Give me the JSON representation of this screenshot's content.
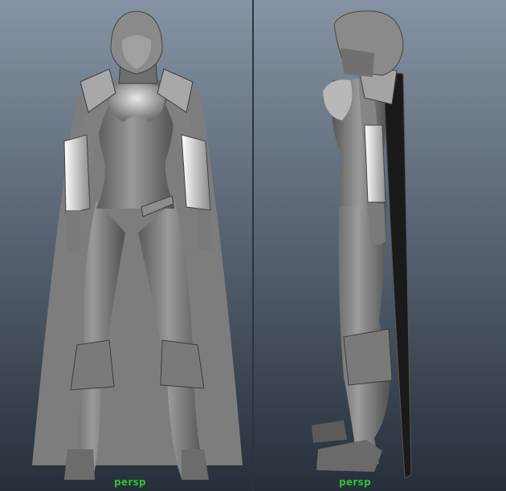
{
  "viewports": {
    "front": {
      "camera_label": "persp",
      "subject": "character-front"
    },
    "side": {
      "camera_label": "persp",
      "subject": "character-side"
    }
  },
  "colors": {
    "bg_top": "#8593a4",
    "bg_bottom": "#262f3a",
    "model_mid": "#8c8c8c",
    "model_dark": "#4a4a4a",
    "model_light": "#d0d0d0",
    "cape": "#7d7d7d",
    "label": "#2fc22f"
  }
}
